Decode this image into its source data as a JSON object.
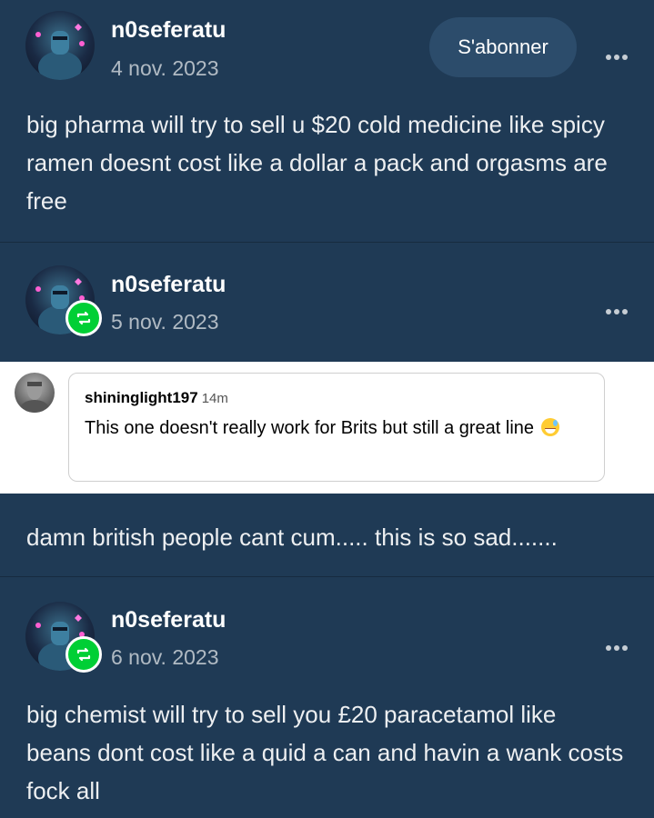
{
  "post1": {
    "username": "n0seferatu",
    "date": "4 nov. 2023",
    "follow_label": "S'abonner",
    "text": "big pharma will try to sell u $20 cold medicine like spicy ramen doesnt cost like a dollar a pack and orgasms are free"
  },
  "post2": {
    "username": "n0seferatu",
    "date": "5 nov. 2023",
    "comment": {
      "username": "shininglight197",
      "time": "14m",
      "text": "This one doesn't really work for Brits but still a great line",
      "emoji": "sweat-smile-emoji"
    },
    "text": "damn british people cant cum..... this is so sad......."
  },
  "post3": {
    "username": "n0seferatu",
    "date": "6 nov. 2023",
    "text": "big chemist will try to sell you £20 paracetamol like beans dont cost like a quid a can and havin a wank costs fock all"
  },
  "icons": {
    "more": "more-options-icon",
    "reblog": "reblog-icon",
    "reblog_color": "#00cf35",
    "background": "#1f3a55"
  }
}
